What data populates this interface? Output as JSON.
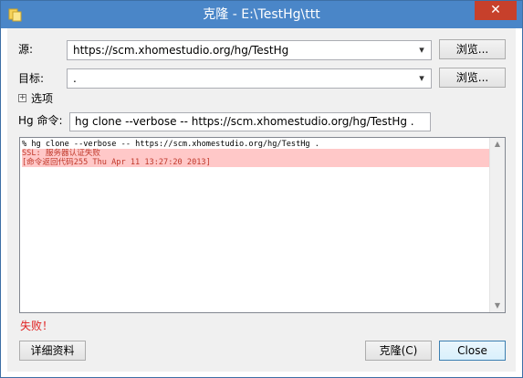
{
  "window": {
    "title": "克隆 - E:\\TestHg\\ttt",
    "close_glyph": "✕",
    "icon": "folder-app-icon",
    "colors": {
      "titlebar": "#4a86c8",
      "close": "#c7402b",
      "status_error": "#e02020",
      "log_error_bg": "#ffc8c8"
    }
  },
  "form": {
    "source_label": "源:",
    "source_value": "https://scm.xhomestudio.org/hg/TestHg",
    "dest_label": "目标:",
    "dest_value": ".",
    "browse_label": "浏览...",
    "options_label": "选项",
    "expander_glyph": "+",
    "hg_cmd_label": "Hg 命令:",
    "hg_cmd_value": "hg clone --verbose -- https://scm.xhomestudio.org/hg/TestHg ."
  },
  "log": {
    "lines": [
      {
        "text": "% hg clone --verbose -- https://scm.xhomestudio.org/hg/TestHg .",
        "kind": "normal"
      },
      {
        "text": "SSL: 服务器认证失败",
        "kind": "error"
      },
      {
        "text": "[命令返回代码255 Thu Apr 11 13:27:20 2013]",
        "kind": "error"
      }
    ]
  },
  "status": {
    "text": "失败！"
  },
  "buttons": {
    "details": "详细资料",
    "clone": "克隆(C)",
    "close": "Close"
  }
}
